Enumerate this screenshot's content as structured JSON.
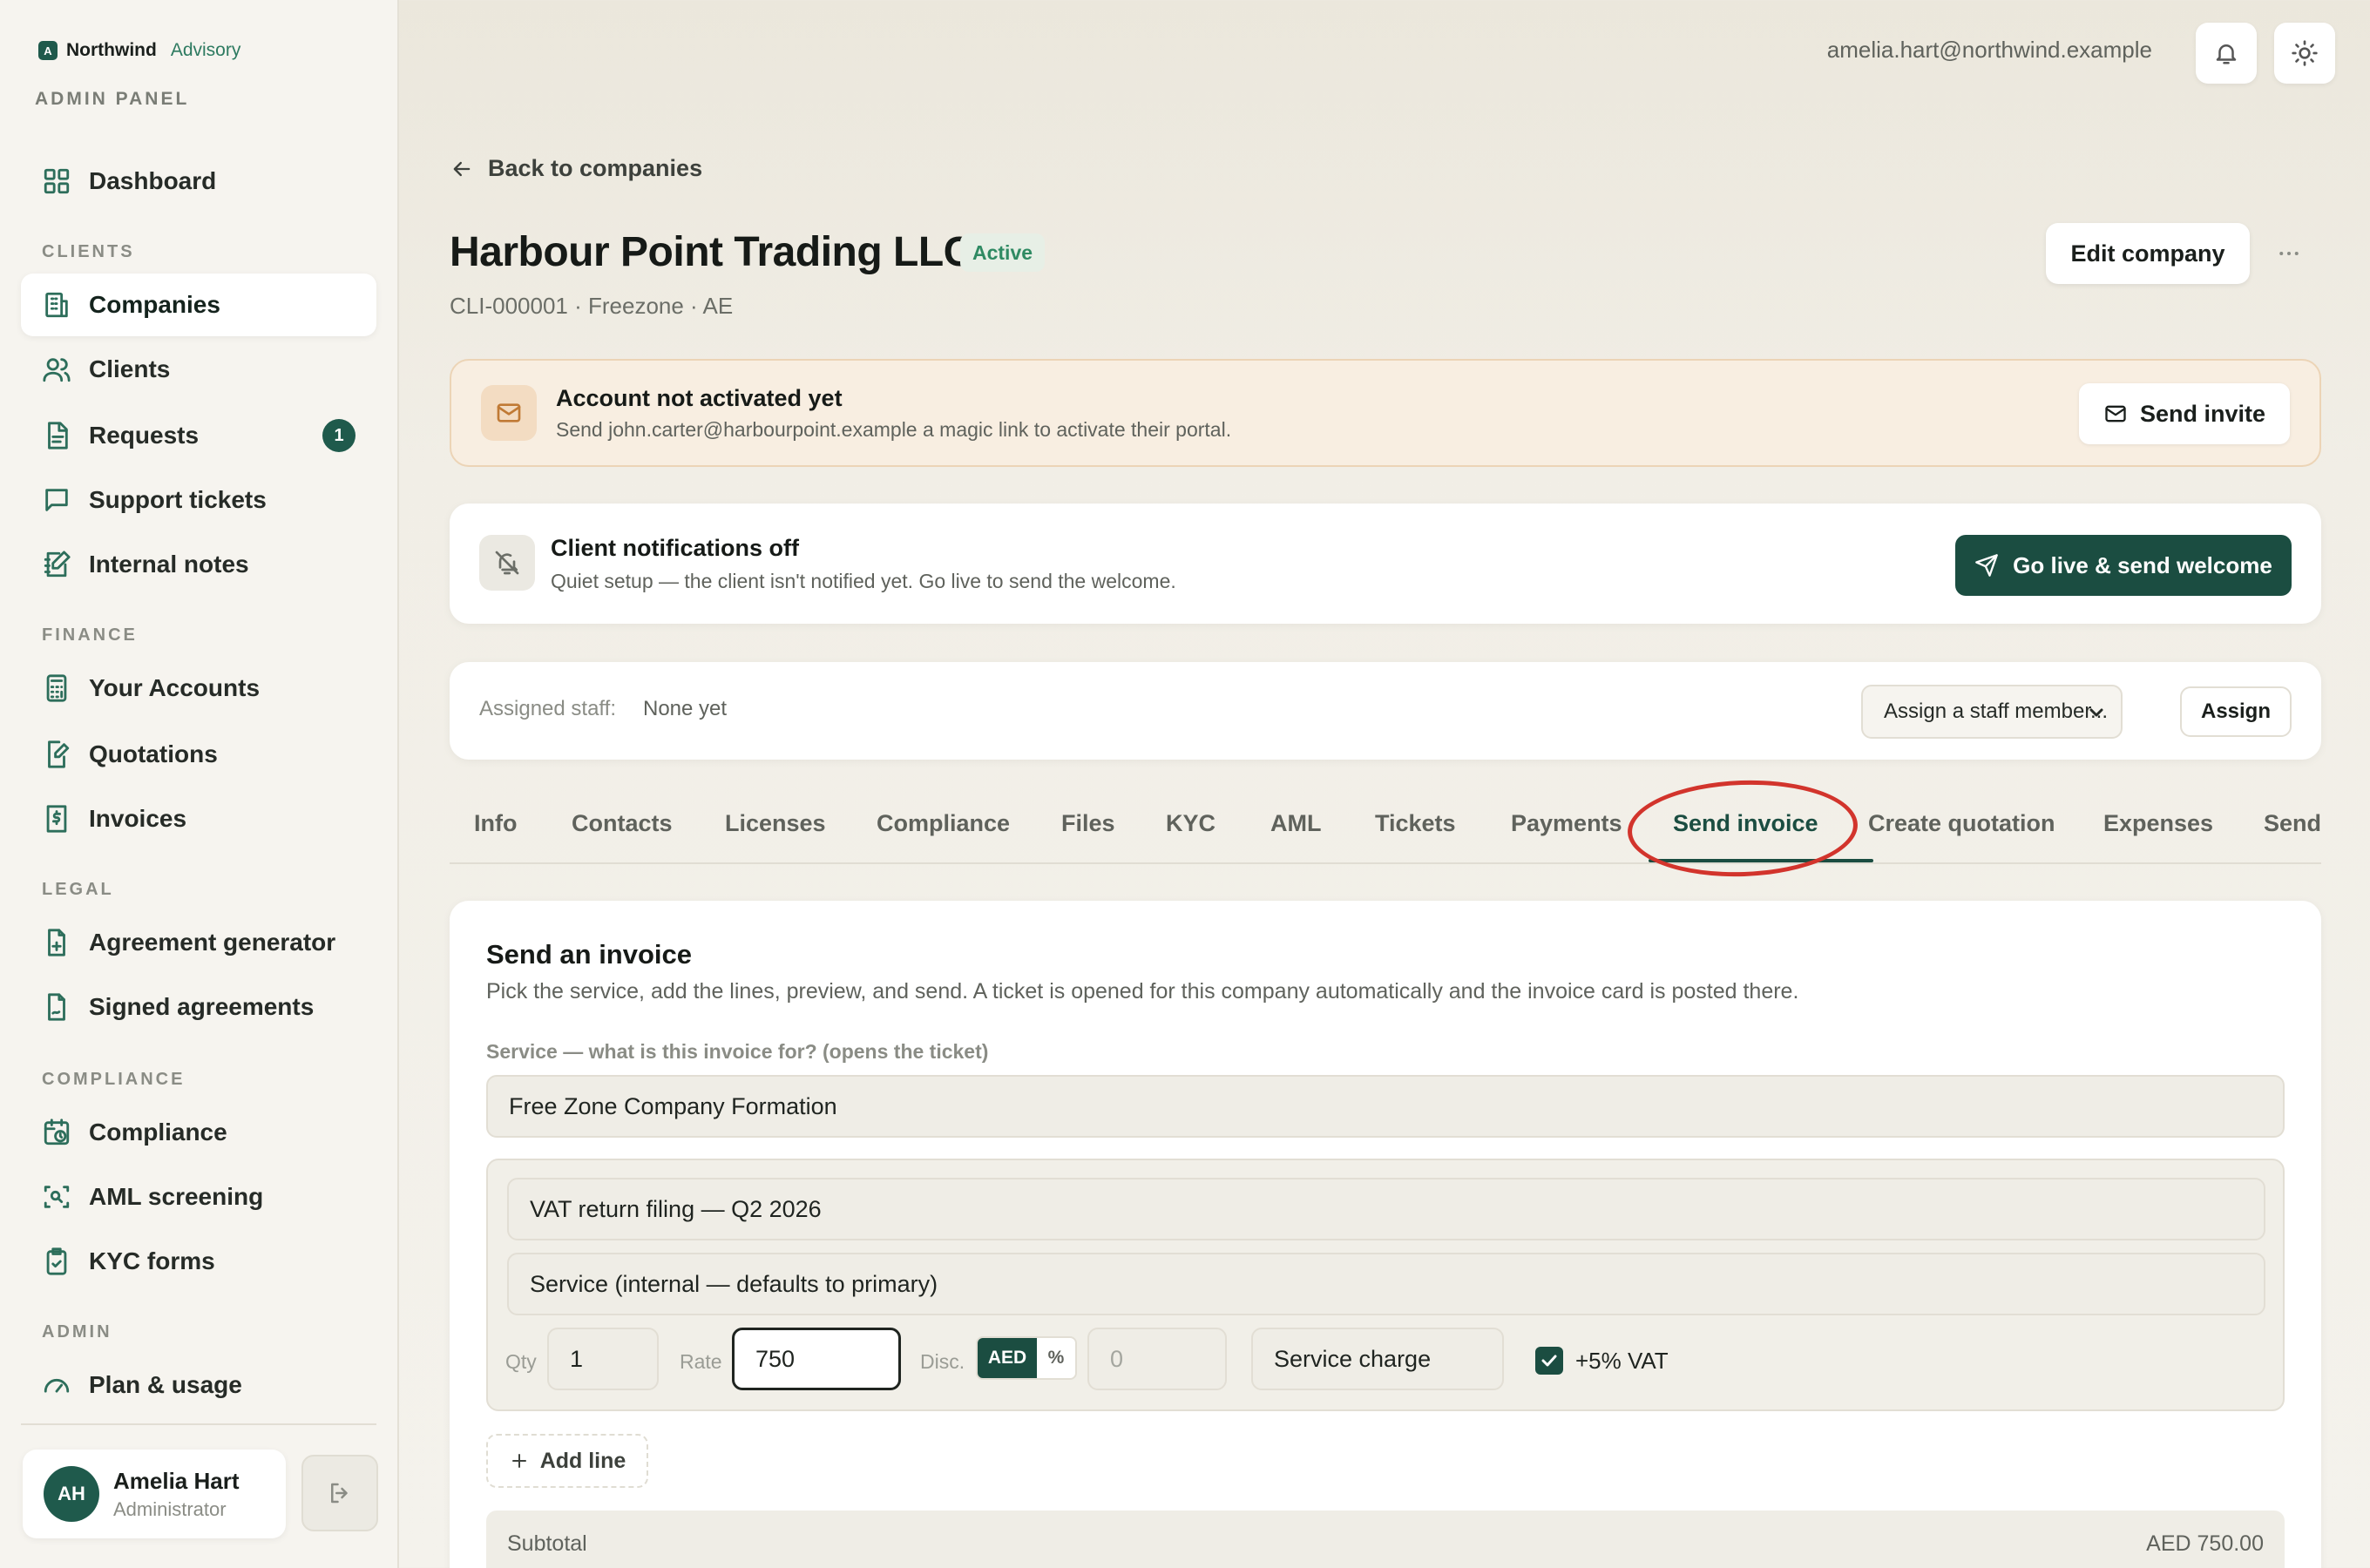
{
  "brand": {
    "logo_letter": "A",
    "name": "Northwind",
    "sub": "Advisory",
    "panel_label": "ADMIN PANEL"
  },
  "sidebar": {
    "sections": {
      "clients": "CLIENTS",
      "finance": "FINANCE",
      "legal": "LEGAL",
      "compliance": "COMPLIANCE",
      "admin": "ADMIN"
    },
    "items": {
      "dashboard": "Dashboard",
      "companies": "Companies",
      "clients": "Clients",
      "requests": "Requests",
      "requests_badge": "1",
      "support": "Support tickets",
      "notes": "Internal notes",
      "accounts": "Your Accounts",
      "quotations": "Quotations",
      "invoices": "Invoices",
      "agreement_gen": "Agreement generator",
      "signed": "Signed agreements",
      "compliance": "Compliance",
      "aml": "AML screening",
      "kyc": "KYC forms",
      "plan": "Plan & usage"
    },
    "user": {
      "initials": "AH",
      "name": "Amelia Hart",
      "role": "Administrator"
    }
  },
  "topbar": {
    "email": "amelia.hart@northwind.example"
  },
  "page": {
    "back_label": "Back to companies",
    "title": "Harbour Point Trading LLC",
    "status": "Active",
    "subtitle": "CLI-000001 · Freezone · AE",
    "edit_label": "Edit company"
  },
  "banners": {
    "account": {
      "title": "Account not activated yet",
      "text": "Send john.carter@harbourpoint.example a magic link to activate their portal.",
      "button": "Send invite"
    },
    "notifications": {
      "title": "Client notifications off",
      "text": "Quiet setup — the client isn't notified yet. Go live to send the welcome.",
      "button": "Go live & send welcome"
    },
    "staff": {
      "label": "Assigned staff:",
      "value": "None yet",
      "select": "Assign a staff member...",
      "button": "Assign"
    }
  },
  "tabs": [
    "Info",
    "Contacts",
    "Licenses",
    "Compliance",
    "Files",
    "KYC",
    "AML",
    "Tickets",
    "Payments",
    "Send invoice",
    "Create quotation",
    "Expenses",
    "Send"
  ],
  "invoice": {
    "title": "Send an invoice",
    "description": "Pick the service, add the lines, preview, and send. A ticket is opened for this company automatically and the invoice card is posted there.",
    "service_label": "Service — what is this invoice for? (opens the ticket)",
    "service_value": "Free Zone Company Formation",
    "line_description": "VAT return filing — Q2 2026",
    "line_service": "Service (internal — defaults to primary)",
    "qty_label": "Qty",
    "qty_value": "1",
    "rate_label": "Rate",
    "rate_value": "750",
    "disc_label": "Disc.",
    "disc_aed": "AED",
    "disc_pct": "%",
    "disc_placeholder": "0",
    "charge_type": "Service charge",
    "vat_label": "+5% VAT",
    "vat_checked": true,
    "add_line": "Add line",
    "subtotal_label": "Subtotal",
    "subtotal_value": "AED 750.00"
  },
  "colors": {
    "accent": "#1b4d41",
    "highlight": "#d2342c",
    "active_green": "#2f8a63",
    "warn_bg": "#f8eee1"
  }
}
